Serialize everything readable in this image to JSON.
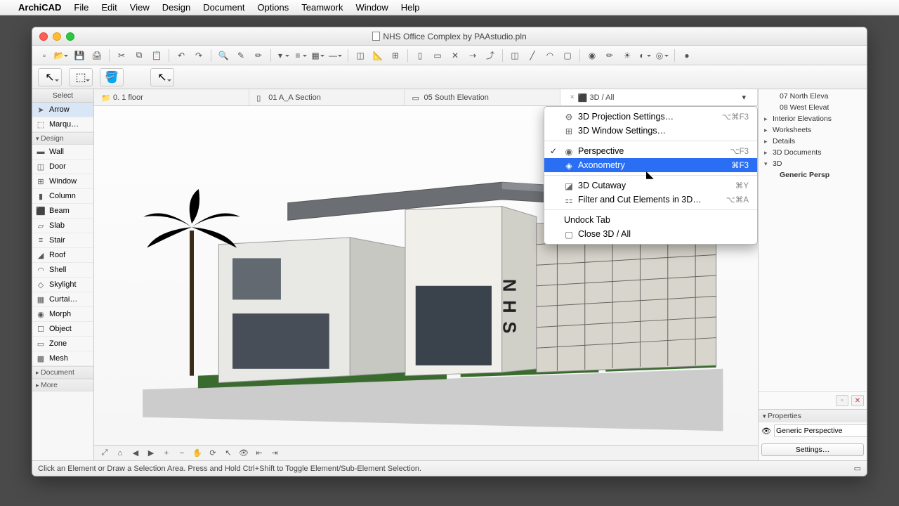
{
  "menubar": {
    "apple": "",
    "app": "ArchiCAD",
    "items": [
      "File",
      "Edit",
      "View",
      "Design",
      "Document",
      "Options",
      "Teamwork",
      "Window",
      "Help"
    ]
  },
  "window": {
    "title": "NHS Office Complex by PAAstudio.pln"
  },
  "toolbar1_groups": [
    [
      "new-doc",
      "open",
      "save",
      "print"
    ],
    [
      "cut",
      "copy",
      "paste"
    ],
    [
      "undo",
      "redo"
    ],
    [
      "zoom-tool",
      "edit-poly",
      "pencil"
    ],
    [
      "select-mode",
      "layers",
      "fill-style",
      "dim-style"
    ],
    [
      "trace",
      "measure",
      "grid"
    ],
    [
      "section",
      "elevation",
      "close-x",
      "link",
      "break"
    ],
    [
      "door",
      "window",
      "curtain"
    ],
    [
      "render",
      "material",
      "sun",
      "shadow",
      "env"
    ],
    [
      "publish"
    ]
  ],
  "toolbar2": [
    "pointer-tool",
    "marquee-tool",
    "bucket-tool",
    "arrow-tool"
  ],
  "toolbox": {
    "select_label": "Select",
    "select_tools": [
      {
        "id": "arrow",
        "label": "Arrow",
        "icon": "➤"
      },
      {
        "id": "marquee",
        "label": "Marqu…",
        "icon": "⬚"
      }
    ],
    "design_label": "Design",
    "design_tools": [
      {
        "id": "wall",
        "label": "Wall",
        "icon": "▬"
      },
      {
        "id": "door",
        "label": "Door",
        "icon": "◫"
      },
      {
        "id": "window",
        "label": "Window",
        "icon": "⊞"
      },
      {
        "id": "column",
        "label": "Column",
        "icon": "▮"
      },
      {
        "id": "beam",
        "label": "Beam",
        "icon": "⬛"
      },
      {
        "id": "slab",
        "label": "Slab",
        "icon": "▱"
      },
      {
        "id": "stair",
        "label": "Stair",
        "icon": "≡"
      },
      {
        "id": "roof",
        "label": "Roof",
        "icon": "◢"
      },
      {
        "id": "shell",
        "label": "Shell",
        "icon": "◠"
      },
      {
        "id": "skylight",
        "label": "Skylight",
        "icon": "◇"
      },
      {
        "id": "curtain",
        "label": "Curtai…",
        "icon": "▦"
      },
      {
        "id": "morph",
        "label": "Morph",
        "icon": "◉"
      },
      {
        "id": "object",
        "label": "Object",
        "icon": "☐"
      },
      {
        "id": "zone",
        "label": "Zone",
        "icon": "▭"
      },
      {
        "id": "mesh",
        "label": "Mesh",
        "icon": "▩"
      }
    ],
    "sub_groups": [
      "Document",
      "More"
    ]
  },
  "viewtabs": [
    {
      "id": "floor",
      "label": "0. 1 floor",
      "icon": "📁"
    },
    {
      "id": "section",
      "label": "01 A_A Section",
      "icon": "▯"
    },
    {
      "id": "elev",
      "label": "05 South Elevation",
      "icon": "▭"
    },
    {
      "id": "3d",
      "label": "3D / All",
      "icon": "⬛",
      "active": true,
      "closeable": true
    }
  ],
  "popup": {
    "items": [
      {
        "label": "3D Projection Settings…",
        "shortcut": "⌥⌘F3",
        "icon": "⚙"
      },
      {
        "label": "3D Window Settings…",
        "icon": "⊞"
      },
      {
        "sep": true
      },
      {
        "label": "Perspective",
        "shortcut": "⌥F3",
        "icon": "◉",
        "checked": true
      },
      {
        "label": "Axonometry",
        "shortcut": "⌘F3",
        "icon": "◈",
        "selected": true
      },
      {
        "sep": true
      },
      {
        "label": "3D Cutaway",
        "shortcut": "⌘Y",
        "icon": "◪"
      },
      {
        "label": "Filter and Cut Elements in 3D…",
        "shortcut": "⌥⌘A",
        "icon": "⚏"
      },
      {
        "sep": true
      },
      {
        "label": "Undock Tab"
      },
      {
        "label": "Close 3D / All",
        "icon": "▢"
      }
    ]
  },
  "navigator": {
    "nodes": [
      {
        "label": "07 North Eleva",
        "lvl": 2,
        "icon": "▭"
      },
      {
        "label": "08 West Elevat",
        "lvl": 2,
        "icon": "▭"
      },
      {
        "label": "Interior Elevations",
        "lvl": 1,
        "tw": "▸",
        "icon": "▯"
      },
      {
        "label": "Worksheets",
        "lvl": 1,
        "tw": "▸",
        "icon": "▭"
      },
      {
        "label": "Details",
        "lvl": 1,
        "tw": "▸",
        "icon": "▫"
      },
      {
        "label": "3D Documents",
        "lvl": 1,
        "tw": "▸",
        "icon": "▫"
      },
      {
        "label": "3D",
        "lvl": 1,
        "tw": "▾",
        "icon": "⬛",
        "bold": false
      },
      {
        "label": "Generic Persp",
        "lvl": 2,
        "icon": "◉",
        "bold": true
      }
    ],
    "properties_label": "Properties",
    "view_name": "Generic Perspective",
    "settings_btn": "Settings…"
  },
  "statusbar": {
    "hint": "Click an Element or Draw a Selection Area. Press and Hold Ctrl+Shift to Toggle Element/Sub-Element Selection."
  }
}
